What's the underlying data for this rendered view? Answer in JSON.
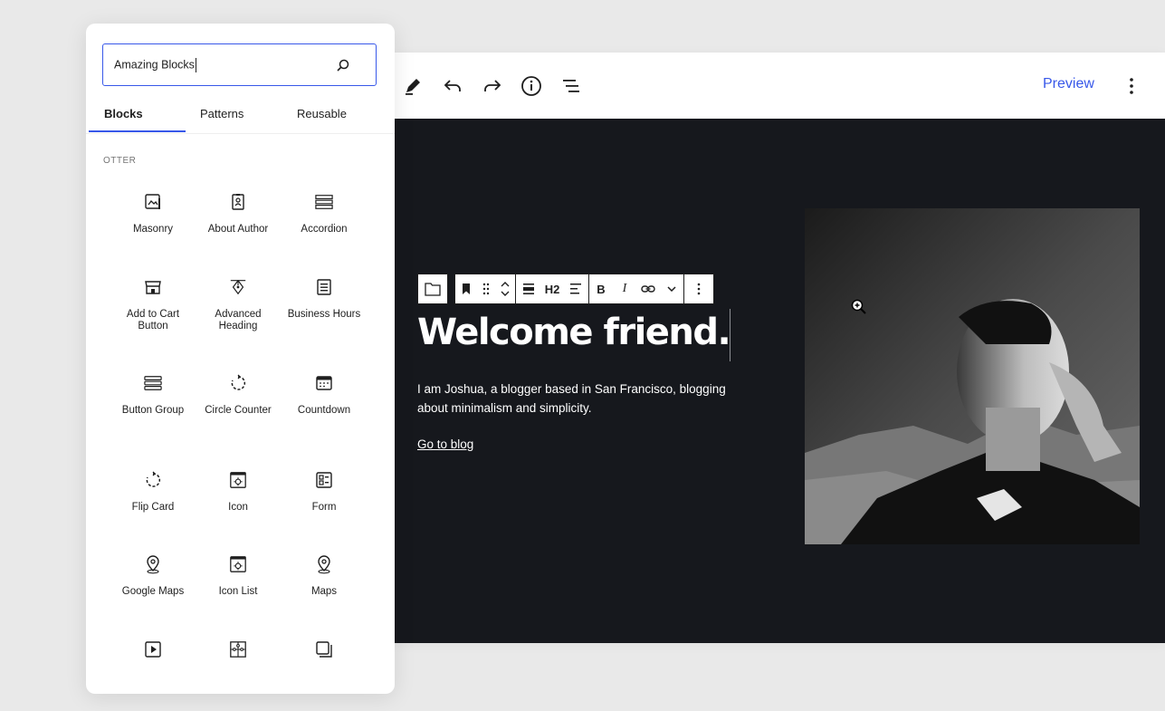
{
  "toolbar": {
    "preview_label": "Preview"
  },
  "block_toolbar": {
    "heading_level": "H2",
    "bold": "B",
    "italic": "I"
  },
  "hero": {
    "title": "Welcome friend.",
    "text": "I am Joshua, a blogger based in San Francisco, blogging about minimalism and simplicity.",
    "link": "Go to blog"
  },
  "inserter": {
    "search_value": "Amazing Blocks",
    "tabs": [
      {
        "label": "Blocks"
      },
      {
        "label": "Patterns"
      },
      {
        "label": "Reusable"
      }
    ],
    "category": "OTTER",
    "blocks": [
      {
        "label": "Masonry",
        "icon": "masonry-icon"
      },
      {
        "label": "About Author",
        "icon": "about-author-icon"
      },
      {
        "label": "Accordion",
        "icon": "accordion-icon"
      },
      {
        "label": "Add to Cart Button",
        "icon": "store-icon"
      },
      {
        "label": "Advanced Heading",
        "icon": "pen-nib-icon"
      },
      {
        "label": "Business Hours",
        "icon": "list-icon"
      },
      {
        "label": "Button Group",
        "icon": "button-group-icon"
      },
      {
        "label": "Circle Counter",
        "icon": "circle-counter-icon"
      },
      {
        "label": "Countdown",
        "icon": "calendar-icon"
      },
      {
        "label": "Flip Card",
        "icon": "flip-card-icon"
      },
      {
        "label": "Icon",
        "icon": "icon-block-icon"
      },
      {
        "label": "Form",
        "icon": "form-icon"
      },
      {
        "label": "Google Maps",
        "icon": "map-pin-icon"
      },
      {
        "label": "Icon List",
        "icon": "icon-list-icon"
      },
      {
        "label": "Maps",
        "icon": "map-pin-icon"
      },
      {
        "label": "",
        "icon": "video-icon"
      },
      {
        "label": "",
        "icon": "puzzle-icon"
      },
      {
        "label": "",
        "icon": "duplicate-icon"
      }
    ]
  }
}
